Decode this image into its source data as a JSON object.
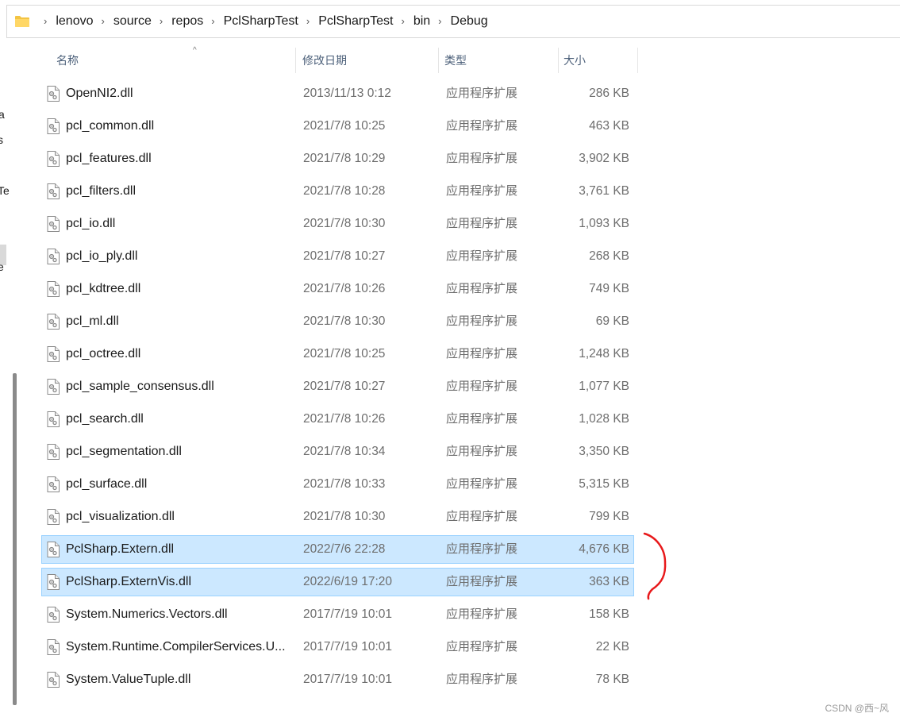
{
  "breadcrumb": [
    "lenovo",
    "source",
    "repos",
    "PclSharpTest",
    "PclSharpTest",
    "bin",
    "Debug"
  ],
  "nav_fragments": [
    "a",
    "s",
    "Te",
    "e"
  ],
  "columns": {
    "name": "名称",
    "date": "修改日期",
    "type": "类型",
    "size": "大小"
  },
  "files": [
    {
      "name": "OpenNI2.dll",
      "date": "2013/11/13 0:12",
      "type": "应用程序扩展",
      "size": "286 KB",
      "selected": false
    },
    {
      "name": "pcl_common.dll",
      "date": "2021/7/8 10:25",
      "type": "应用程序扩展",
      "size": "463 KB",
      "selected": false
    },
    {
      "name": "pcl_features.dll",
      "date": "2021/7/8 10:29",
      "type": "应用程序扩展",
      "size": "3,902 KB",
      "selected": false
    },
    {
      "name": "pcl_filters.dll",
      "date": "2021/7/8 10:28",
      "type": "应用程序扩展",
      "size": "3,761 KB",
      "selected": false
    },
    {
      "name": "pcl_io.dll",
      "date": "2021/7/8 10:30",
      "type": "应用程序扩展",
      "size": "1,093 KB",
      "selected": false
    },
    {
      "name": "pcl_io_ply.dll",
      "date": "2021/7/8 10:27",
      "type": "应用程序扩展",
      "size": "268 KB",
      "selected": false
    },
    {
      "name": "pcl_kdtree.dll",
      "date": "2021/7/8 10:26",
      "type": "应用程序扩展",
      "size": "749 KB",
      "selected": false
    },
    {
      "name": "pcl_ml.dll",
      "date": "2021/7/8 10:30",
      "type": "应用程序扩展",
      "size": "69 KB",
      "selected": false
    },
    {
      "name": "pcl_octree.dll",
      "date": "2021/7/8 10:25",
      "type": "应用程序扩展",
      "size": "1,248 KB",
      "selected": false
    },
    {
      "name": "pcl_sample_consensus.dll",
      "date": "2021/7/8 10:27",
      "type": "应用程序扩展",
      "size": "1,077 KB",
      "selected": false
    },
    {
      "name": "pcl_search.dll",
      "date": "2021/7/8 10:26",
      "type": "应用程序扩展",
      "size": "1,028 KB",
      "selected": false
    },
    {
      "name": "pcl_segmentation.dll",
      "date": "2021/7/8 10:34",
      "type": "应用程序扩展",
      "size": "3,350 KB",
      "selected": false
    },
    {
      "name": "pcl_surface.dll",
      "date": "2021/7/8 10:33",
      "type": "应用程序扩展",
      "size": "5,315 KB",
      "selected": false
    },
    {
      "name": "pcl_visualization.dll",
      "date": "2021/7/8 10:30",
      "type": "应用程序扩展",
      "size": "799 KB",
      "selected": false
    },
    {
      "name": "PclSharp.Extern.dll",
      "date": "2022/7/6 22:28",
      "type": "应用程序扩展",
      "size": "4,676 KB",
      "selected": true
    },
    {
      "name": "PclSharp.ExternVis.dll",
      "date": "2022/6/19 17:20",
      "type": "应用程序扩展",
      "size": "363 KB",
      "selected": true
    },
    {
      "name": "System.Numerics.Vectors.dll",
      "date": "2017/7/19 10:01",
      "type": "应用程序扩展",
      "size": "158 KB",
      "selected": false
    },
    {
      "name": "System.Runtime.CompilerServices.U...",
      "date": "2017/7/19 10:01",
      "type": "应用程序扩展",
      "size": "22 KB",
      "selected": false
    },
    {
      "name": "System.ValueTuple.dll",
      "date": "2017/7/19 10:01",
      "type": "应用程序扩展",
      "size": "78 KB",
      "selected": false
    }
  ],
  "watermark": "CSDN @西~风",
  "colors": {
    "selection_bg": "#cce8ff",
    "selection_border": "#99d1ff",
    "header_text": "#4c607a",
    "annotation": "#e8191b"
  }
}
